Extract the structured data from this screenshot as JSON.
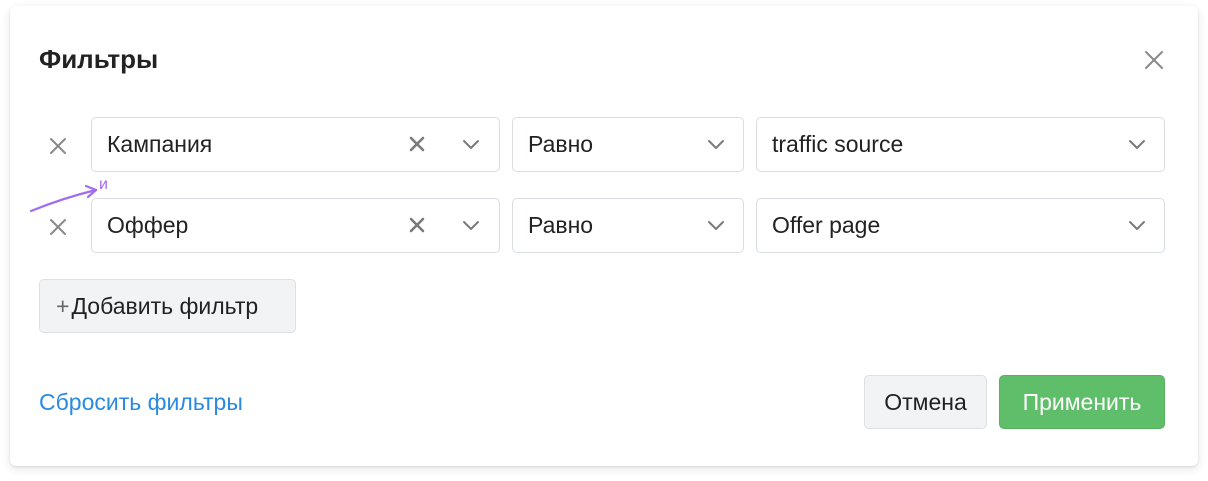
{
  "dialog": {
    "title": "Фильтры",
    "close_icon": "close-icon"
  },
  "filters": [
    {
      "field": "Кампания",
      "operator": "Равно",
      "value": "traffic source"
    },
    {
      "field": "Оффер",
      "operator": "Равно",
      "value": "Offer page"
    }
  ],
  "connector_label": "и",
  "add_filter_label": "Добавить фильтр",
  "footer": {
    "reset_label": "Сбросить фильтры",
    "cancel_label": "Отмена",
    "apply_label": "Применить"
  },
  "colors": {
    "link": "#2a8ae0",
    "apply": "#5fbe69",
    "annotation": "#a06cf0"
  }
}
